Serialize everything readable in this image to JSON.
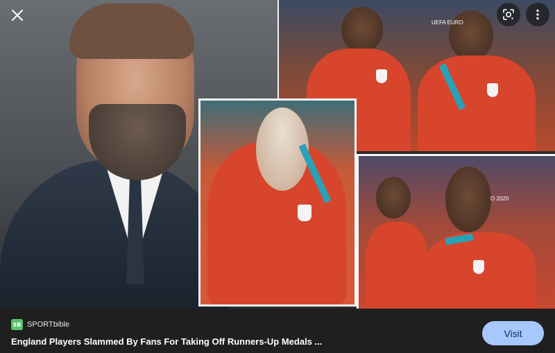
{
  "viewer": {
    "close_icon": "close-icon",
    "lens_icon": "google-lens-icon",
    "more_icon": "more-vert-icon"
  },
  "image": {
    "banner_text_top": "UEFA EURO",
    "banner_text_bottom": "O 2020"
  },
  "footer": {
    "source_favicon_text": "SB",
    "source_name": "SPORTbible",
    "headline": "England Players Slammed By Fans For Taking Off Runners-Up Medals ...",
    "visit_label": "Visit"
  },
  "colors": {
    "background": "#1f1f1f",
    "visit_button": "#a8c7fa",
    "visit_text": "#062e6f",
    "favicon": "#59c36a"
  }
}
